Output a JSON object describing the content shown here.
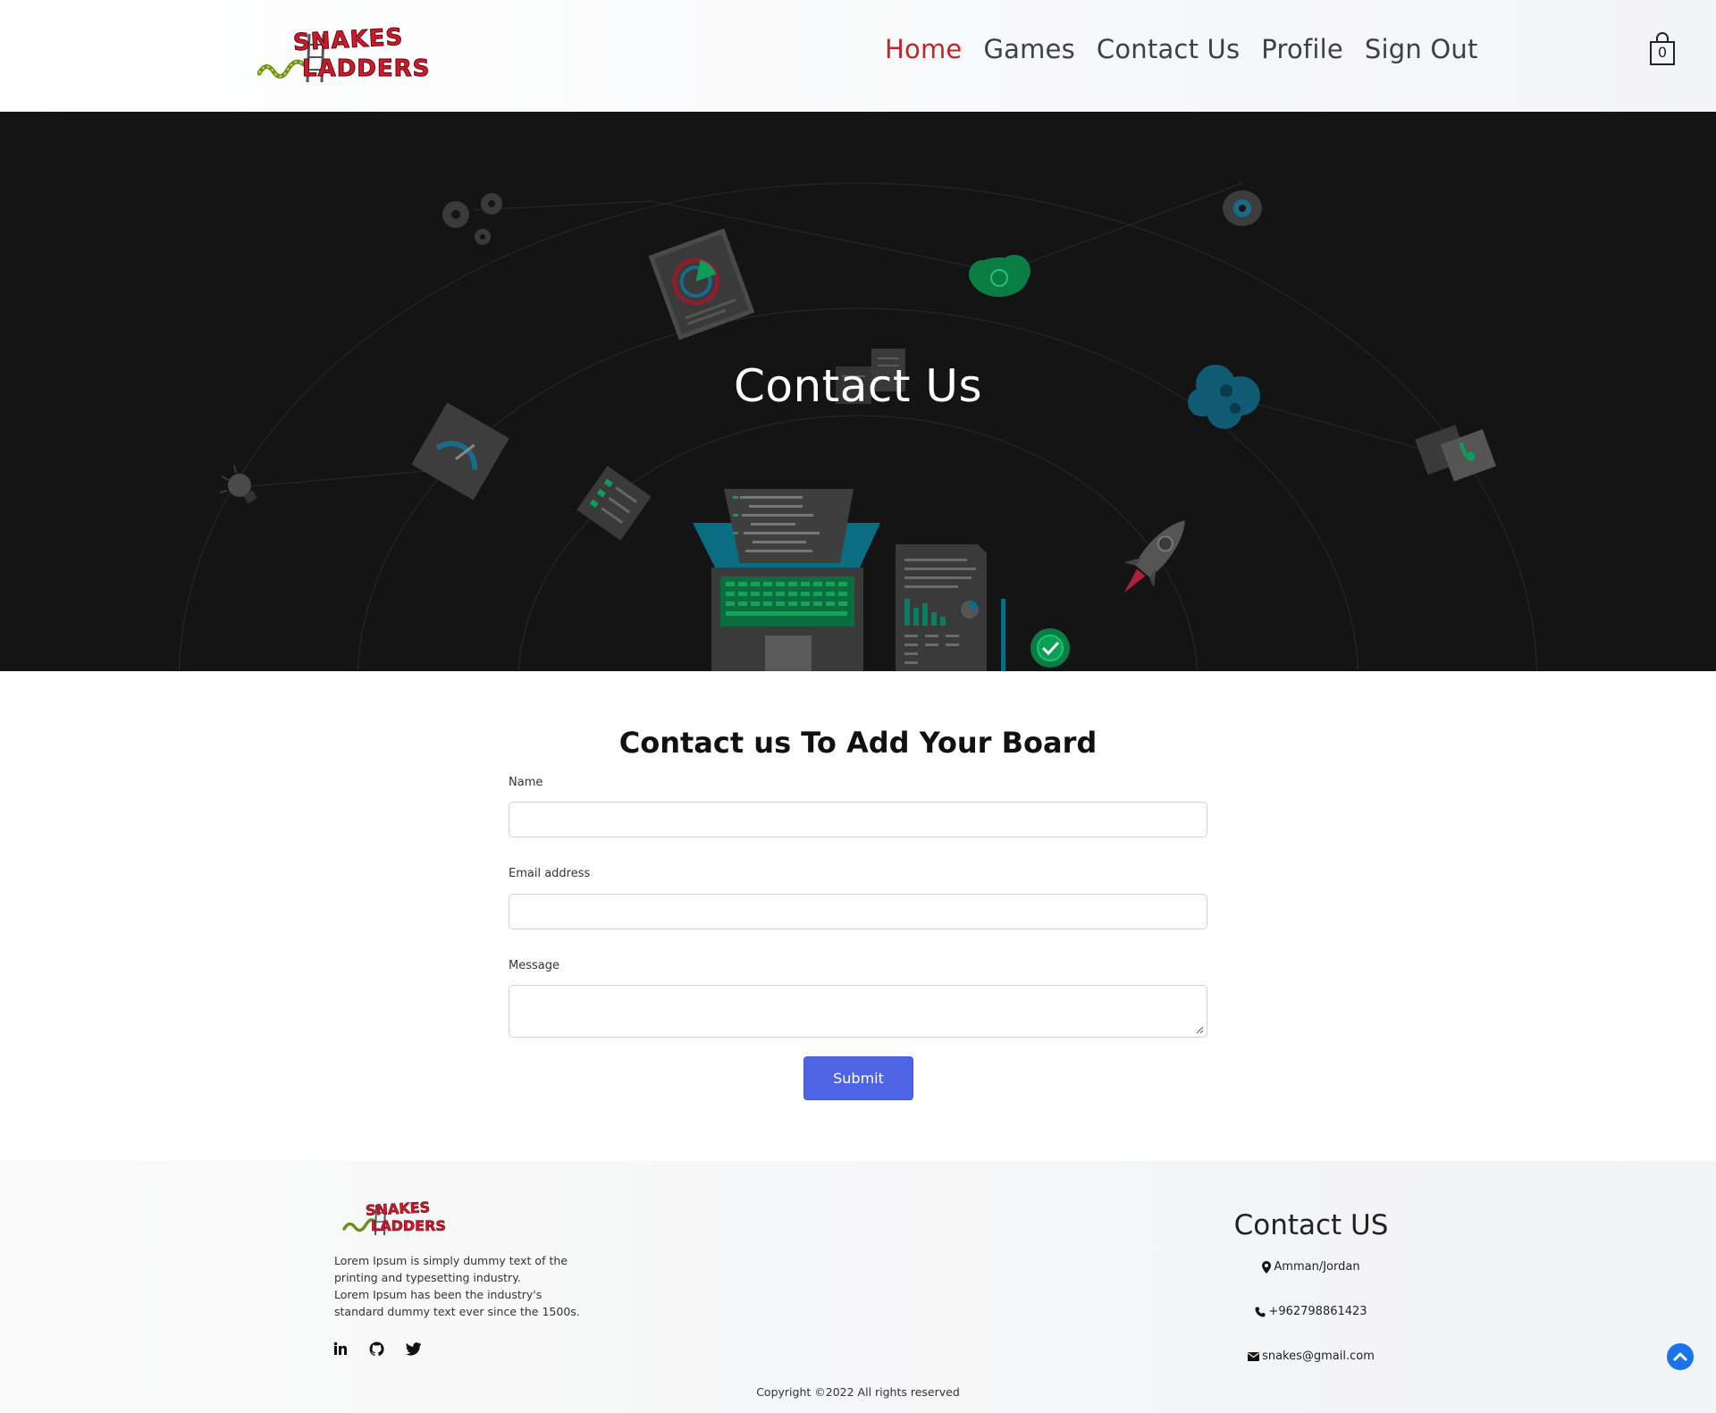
{
  "brand": {
    "logo_top": "SNAKES",
    "logo_bottom": "LADDERS"
  },
  "nav": {
    "items": [
      {
        "label": "Home",
        "active": true
      },
      {
        "label": "Games",
        "active": false
      },
      {
        "label": "Contact Us",
        "active": false
      },
      {
        "label": "Profile",
        "active": false
      },
      {
        "label": "Sign Out",
        "active": false
      }
    ],
    "active_color": "#c0272d",
    "cart_count": "0"
  },
  "hero": {
    "title": "Contact Us"
  },
  "form": {
    "title": "Contact us To Add Your Board",
    "name_label": "Name",
    "name_value": "",
    "email_label": "Email address",
    "email_value": "",
    "message_label": "Message",
    "message_value": "",
    "submit_label": "Submit",
    "submit_color": "#4f63e7"
  },
  "footer": {
    "about_line1": "Lorem Ipsum is simply dummy text of the",
    "about_line2": "printing and typesetting industry.",
    "about_line3": "Lorem Ipsum has been the industry's",
    "about_line4": "standard dummy text ever since the 1500s.",
    "social": [
      "linkedin-icon",
      "github-icon",
      "twitter-icon"
    ],
    "contact_title": "Contact US",
    "location": "Amman/Jordan",
    "phone": "+962798861423",
    "email": "snakes@gmail.com",
    "copyright": "Copyright ©2022 All rights reserved"
  }
}
